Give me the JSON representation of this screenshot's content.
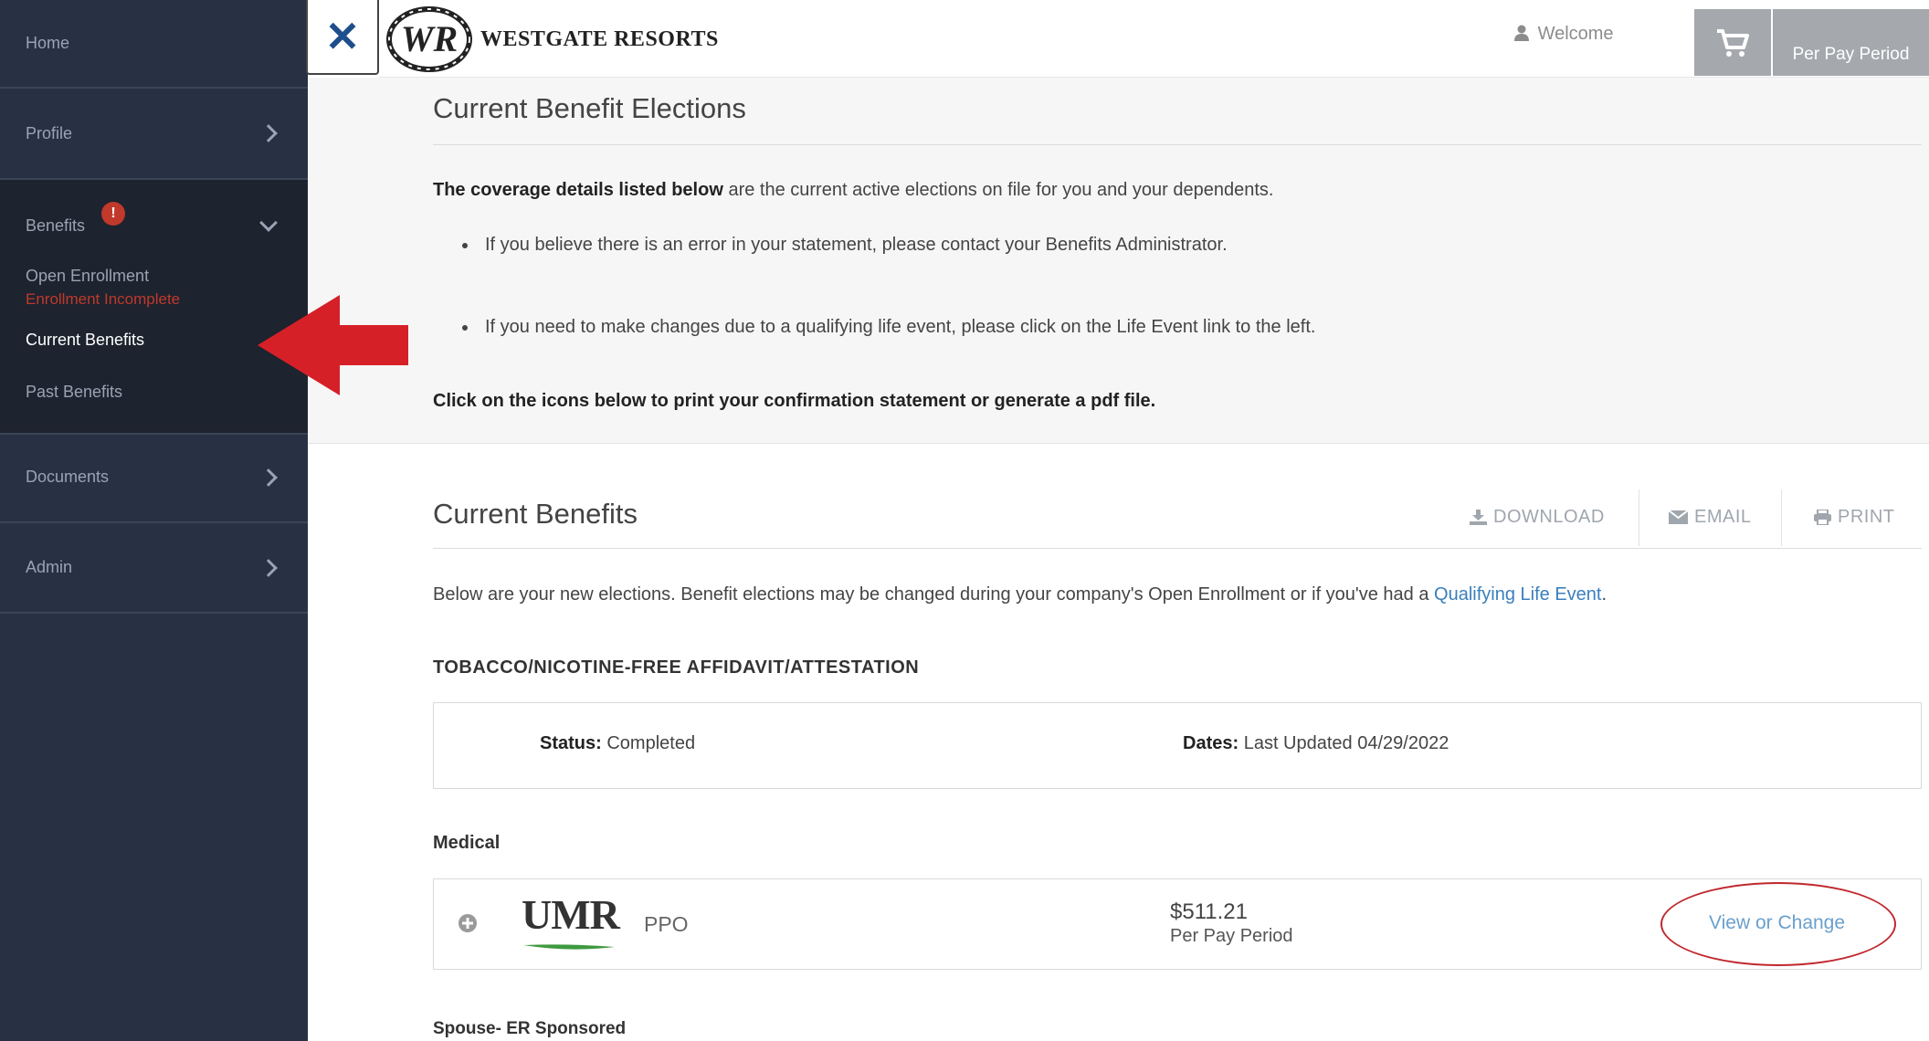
{
  "sidebar": {
    "home": "Home",
    "profile": "Profile",
    "benefits": "Benefits",
    "benefits_badge": "!",
    "open_enrollment": "Open Enrollment",
    "enrollment_status": "Enrollment Incomplete",
    "current_benefits": "Current Benefits",
    "past_benefits": "Past Benefits",
    "documents": "Documents",
    "admin": "Admin"
  },
  "header": {
    "close_icon": "close-icon",
    "logo_initials": "WR",
    "logo_text": "WESTGATE RESORTS",
    "welcome": "Welcome",
    "cart_icon": "cart-icon",
    "per_pay_period": "Per Pay Period"
  },
  "elections": {
    "title": "Current Benefit Elections",
    "intro_bold": "The coverage details listed below",
    "intro_rest": " are the current active elections on file for you and your dependents.",
    "bullet1": "If you believe there is an error in your statement, please contact your Benefits Administrator.",
    "bullet2": "If you need to make changes due to a qualifying life event, please click on the Life Event link to the left.",
    "print_note": "Click on the icons below to print your confirmation statement or generate a pdf file."
  },
  "current": {
    "title": "Current Benefits",
    "download": "DOWNLOAD",
    "email": "EMAIL",
    "print": "PRINT",
    "desc_before": "Below are your new elections. Benefit elections may be changed during your company's Open Enrollment or if you've had a ",
    "desc_link": "Qualifying Life Event",
    "desc_after": ".",
    "tobacco_title": "TOBACCO/NICOTINE-FREE AFFIDAVIT/ATTESTATION",
    "status_label": "Status:",
    "status_value": " Completed",
    "dates_label": "Dates:",
    "dates_value": " Last Updated 04/29/2022",
    "medical_label": "Medical",
    "medical_carrier": "UMR",
    "medical_plan": "PPO",
    "medical_amount": "$511.21",
    "medical_period": "Per Pay Period",
    "view_change": "View or Change",
    "spouse_label": "Spouse- ER Sponsored"
  },
  "colors": {
    "sidebar_bg": "#273143",
    "sidebar_active_bg": "#1d232f",
    "alert_red": "#c0392b",
    "link_blue": "#3a7fbd",
    "annotation_red": "#d62027"
  }
}
